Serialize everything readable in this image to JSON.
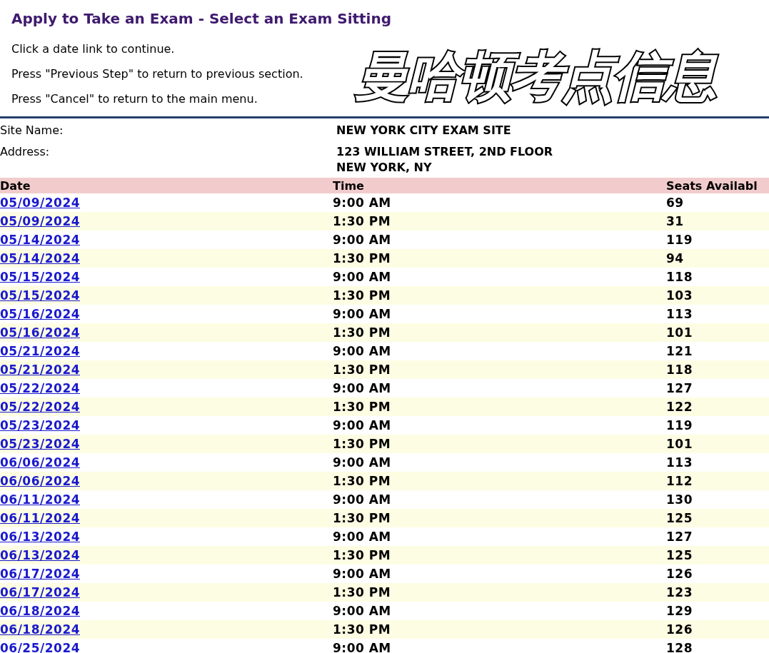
{
  "page_title": "Apply to Take an Exam - Select an Exam Sitting",
  "instructions": [
    "Click a date link to continue.",
    "Press \"Previous Step\" to return to previous section.",
    "Press \"Cancel\" to return to the main menu."
  ],
  "overlay_caption": "曼哈顿考点信息",
  "site": {
    "name_label": "Site Name:",
    "name": "NEW YORK CITY EXAM SITE",
    "address_label": "Address:",
    "address_lines": [
      "123 WILLIAM STREET, 2ND FLOOR",
      "NEW YORK, NY"
    ]
  },
  "table": {
    "columns": [
      "Date",
      "Time",
      "Seats Availabl"
    ],
    "rows": [
      {
        "date": "05/09/2024",
        "time": "9:00 AM",
        "seats": "69"
      },
      {
        "date": "05/09/2024",
        "time": "1:30 PM",
        "seats": "31"
      },
      {
        "date": "05/14/2024",
        "time": "9:00 AM",
        "seats": "119"
      },
      {
        "date": "05/14/2024",
        "time": "1:30 PM",
        "seats": "94"
      },
      {
        "date": "05/15/2024",
        "time": "9:00 AM",
        "seats": "118"
      },
      {
        "date": "05/15/2024",
        "time": "1:30 PM",
        "seats": "103"
      },
      {
        "date": "05/16/2024",
        "time": "9:00 AM",
        "seats": "113"
      },
      {
        "date": "05/16/2024",
        "time": "1:30 PM",
        "seats": "101"
      },
      {
        "date": "05/21/2024",
        "time": "9:00 AM",
        "seats": "121"
      },
      {
        "date": "05/21/2024",
        "time": "1:30 PM",
        "seats": "118"
      },
      {
        "date": "05/22/2024",
        "time": "9:00 AM",
        "seats": "127"
      },
      {
        "date": "05/22/2024",
        "time": "1:30 PM",
        "seats": "122"
      },
      {
        "date": "05/23/2024",
        "time": "9:00 AM",
        "seats": "119"
      },
      {
        "date": "05/23/2024",
        "time": "1:30 PM",
        "seats": "101"
      },
      {
        "date": "06/06/2024",
        "time": "9:00 AM",
        "seats": "113"
      },
      {
        "date": "06/06/2024",
        "time": "1:30 PM",
        "seats": "112"
      },
      {
        "date": "06/11/2024",
        "time": "9:00 AM",
        "seats": "130"
      },
      {
        "date": "06/11/2024",
        "time": "1:30 PM",
        "seats": "125"
      },
      {
        "date": "06/13/2024",
        "time": "9:00 AM",
        "seats": "127"
      },
      {
        "date": "06/13/2024",
        "time": "1:30 PM",
        "seats": "125"
      },
      {
        "date": "06/17/2024",
        "time": "9:00 AM",
        "seats": "126"
      },
      {
        "date": "06/17/2024",
        "time": "1:30 PM",
        "seats": "123"
      },
      {
        "date": "06/18/2024",
        "time": "9:00 AM",
        "seats": "129"
      },
      {
        "date": "06/18/2024",
        "time": "1:30 PM",
        "seats": "126"
      },
      {
        "date": "06/25/2024",
        "time": "9:00 AM",
        "seats": "128"
      }
    ]
  }
}
